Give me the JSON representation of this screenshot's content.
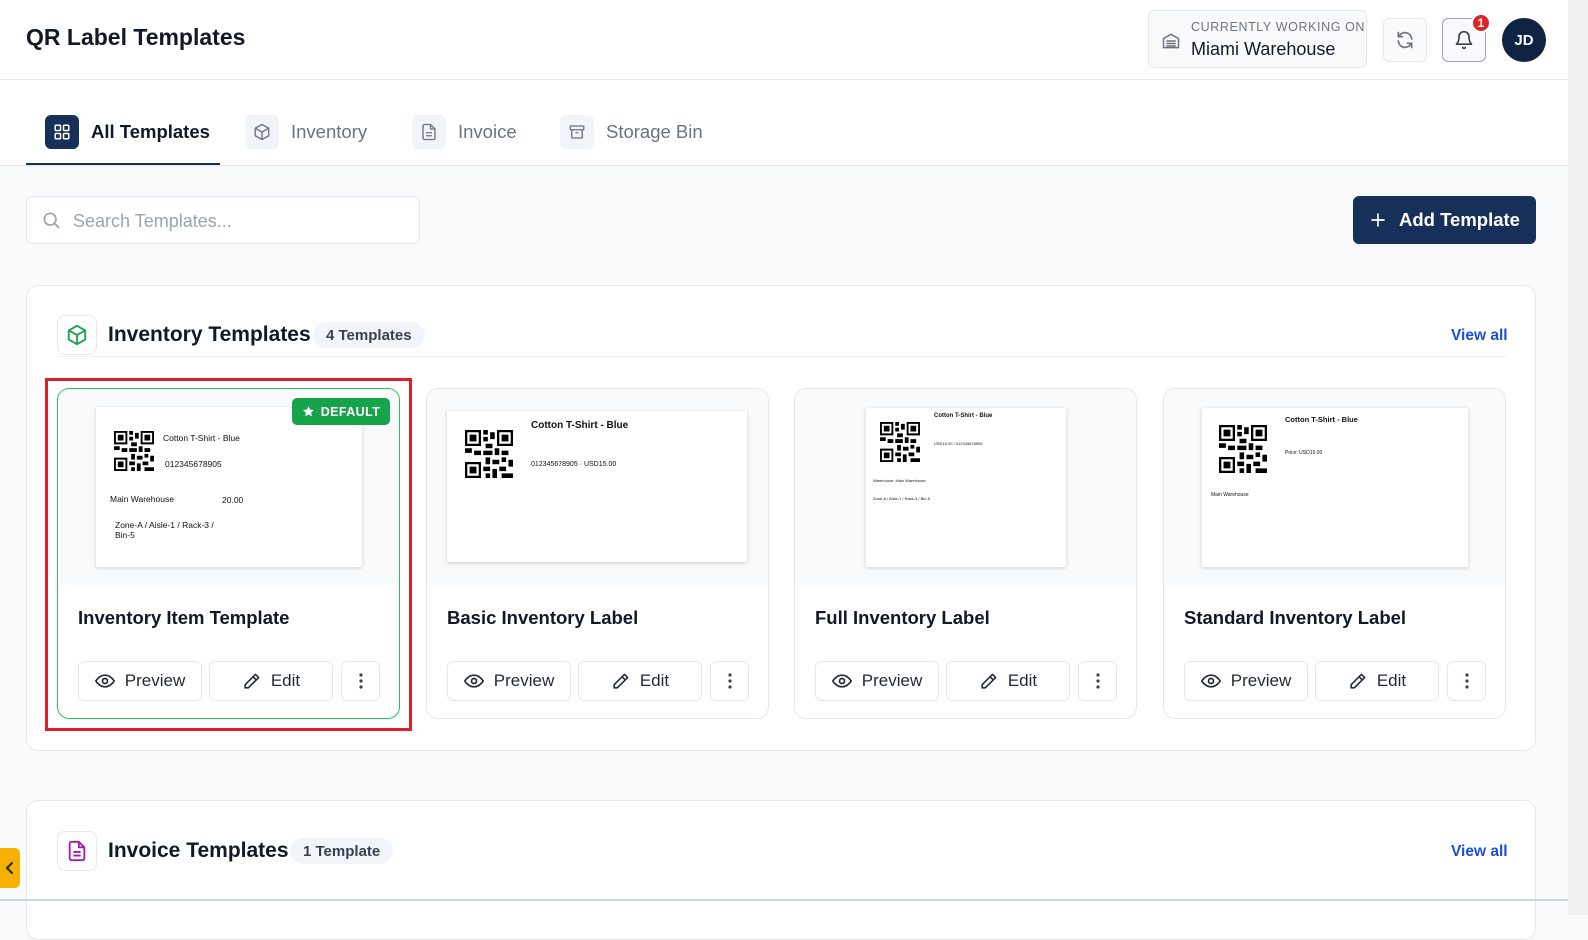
{
  "header": {
    "title": "QR Label Templates",
    "workspace_label": "CURRENTLY WORKING ON",
    "workspace_name": "Miami Warehouse",
    "notification_count": "1",
    "avatar_initials": "JD"
  },
  "tabs": [
    {
      "label": "All Templates",
      "icon": "grid-icon",
      "active": true
    },
    {
      "label": "Inventory",
      "icon": "box-icon",
      "active": false
    },
    {
      "label": "Invoice",
      "icon": "document-icon",
      "active": false
    },
    {
      "label": "Storage Bin",
      "icon": "archive-icon",
      "active": false
    }
  ],
  "search": {
    "placeholder": "Search Templates..."
  },
  "add_button": {
    "label": "Add Template"
  },
  "inventory_section": {
    "title": "Inventory Templates",
    "count": "4 Templates",
    "view_all": "View all",
    "cards": [
      {
        "title": "Inventory Item Template",
        "default_badge": "DEFAULT",
        "preview_name": "Cotton T-Shirt - Blue",
        "preview_sku": "012345678905",
        "preview_warehouse": "Main Warehouse",
        "preview_price": "20.00",
        "preview_location_1": "Zone-A / Aisle-1 / Rack-3 /",
        "preview_location_2": "Bin-5",
        "preview_label": "Preview",
        "edit_label": "Edit"
      },
      {
        "title": "Basic Inventory Label",
        "preview_name": "Cotton T-Shirt - Blue",
        "preview_line": "012345678905 · USD15.00",
        "preview_label": "Preview",
        "edit_label": "Edit"
      },
      {
        "title": "Full Inventory Label",
        "preview_name": "Cotton T-Shirt - Blue",
        "preview_line": "USD15.00 / 012345678905",
        "preview_warehouse": "Warehouse: Main Warehouse",
        "preview_location": "Zone-A / Aisle-1 / Rack-3 / Bin-5",
        "preview_label": "Preview",
        "edit_label": "Edit"
      },
      {
        "title": "Standard Inventory Label",
        "preview_name": "Cotton T-Shirt - Blue",
        "preview_price": "Price: USD15.00",
        "preview_warehouse": "Main Warehouse",
        "preview_label": "Preview",
        "edit_label": "Edit"
      }
    ]
  },
  "invoice_section": {
    "title": "Invoice Templates",
    "count": "1 Template",
    "view_all": "View all"
  },
  "colors": {
    "primary": "#17305a",
    "success": "#16a34a",
    "highlight": "#e11d2a",
    "link": "#1d4ed8",
    "accent_tab": "#f6b100"
  }
}
